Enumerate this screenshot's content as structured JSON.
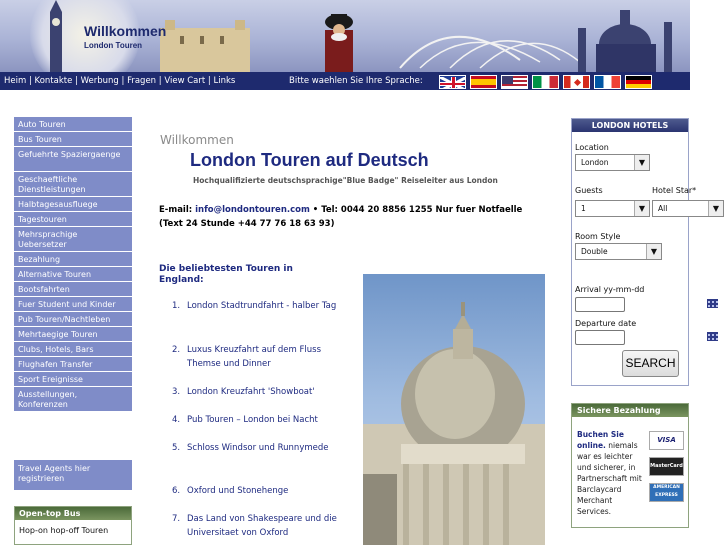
{
  "header": {
    "brand_title": "Willkommen",
    "brand_sub": "London Touren",
    "nav_links": [
      "Heim",
      "Kontakte",
      "Werbung",
      "Fragen",
      "View Cart",
      "Links"
    ],
    "language_prompt": "Bitte waehlen Sie Ihre Sprache:",
    "flags": [
      "flag-uk-icon",
      "flag-spain-icon",
      "flag-usa-icon",
      "flag-italy-icon",
      "flag-canada-icon",
      "flag-france-icon",
      "flag-germany-icon"
    ]
  },
  "sidebar": {
    "items": [
      "Auto Touren",
      "Bus Touren",
      "Gefuehrte Spaziergaenge",
      "Geschaeftliche Dienstleistungen",
      "Halbtagesausfluege",
      "Tagestouren",
      "Mehrsprachige Uebersetzer",
      "Bezahlung",
      "Alternative Touren",
      "Bootsfahrten",
      "Fuer Student und Kinder",
      "Pub Touren/Nachtleben",
      "Mehrtaegige Touren",
      "Clubs, Hotels, Bars",
      "Flughafen Transfer",
      "Sport Ereignisse",
      "Ausstellungen, Konferenzen"
    ],
    "agents_link": "Travel Agents hier registrieren",
    "bus_box_title": "Open-top Bus",
    "bus_box_text": "Hop-on hop-off Touren"
  },
  "main": {
    "welcome": "Willkommen",
    "title": "London Touren auf Deutsch",
    "subtitle": "Hochqualifizierte deutschsprachige\"Blue Badge\" Reiseleiter aus London",
    "contact_prefix": "E-mail: ",
    "contact_email": "info@londontouren.com",
    "contact_rest": " • Tel: 0044 20 8856 1255 Nur fuer Notfaelle (Text 24 Stunde +44 77 76 18 63 93)",
    "popular_title": "Die beliebtesten Touren in England:",
    "tours": [
      {
        "num": "1.",
        "label": "London Stadtrundfahrt - halber Tag"
      },
      {
        "num": "2.",
        "label": "Luxus Kreuzfahrt auf dem Fluss Themse und Dinner"
      },
      {
        "num": "3.",
        "label": "London Kreuzfahrt 'Showboat'"
      },
      {
        "num": "4.",
        "label": "Pub Touren – London bei Nacht"
      },
      {
        "num": "5.",
        "label": "Schloss Windsor und Runnymede"
      },
      {
        "num": "6.",
        "label": "Oxford und Stonehenge"
      },
      {
        "num": "7.",
        "label": "Das Land von Shakespeare und die Universitaet von Oxford"
      }
    ]
  },
  "hotels": {
    "title": "LONDON HOTELS",
    "location_label": "Location",
    "location_value": "London",
    "guests_label": "Guests",
    "guests_value": "1",
    "star_label": "Hotel Star*",
    "star_value": "All",
    "room_label": "Room Style",
    "room_value": "Double",
    "arrival_label": "Arrival yy-mm-dd",
    "departure_label": "Departure date",
    "search_label": "SEARCH"
  },
  "payment": {
    "title": "Sichere Bezahlung",
    "link_text": "Buchen Sie online.",
    "text": " niemals war es leichter und sicherer, in Partnerschaft mit Barclaycard Merchant Services.",
    "cards": [
      "VISA",
      "MasterCard",
      "AMERICAN EXPRESS"
    ]
  }
}
